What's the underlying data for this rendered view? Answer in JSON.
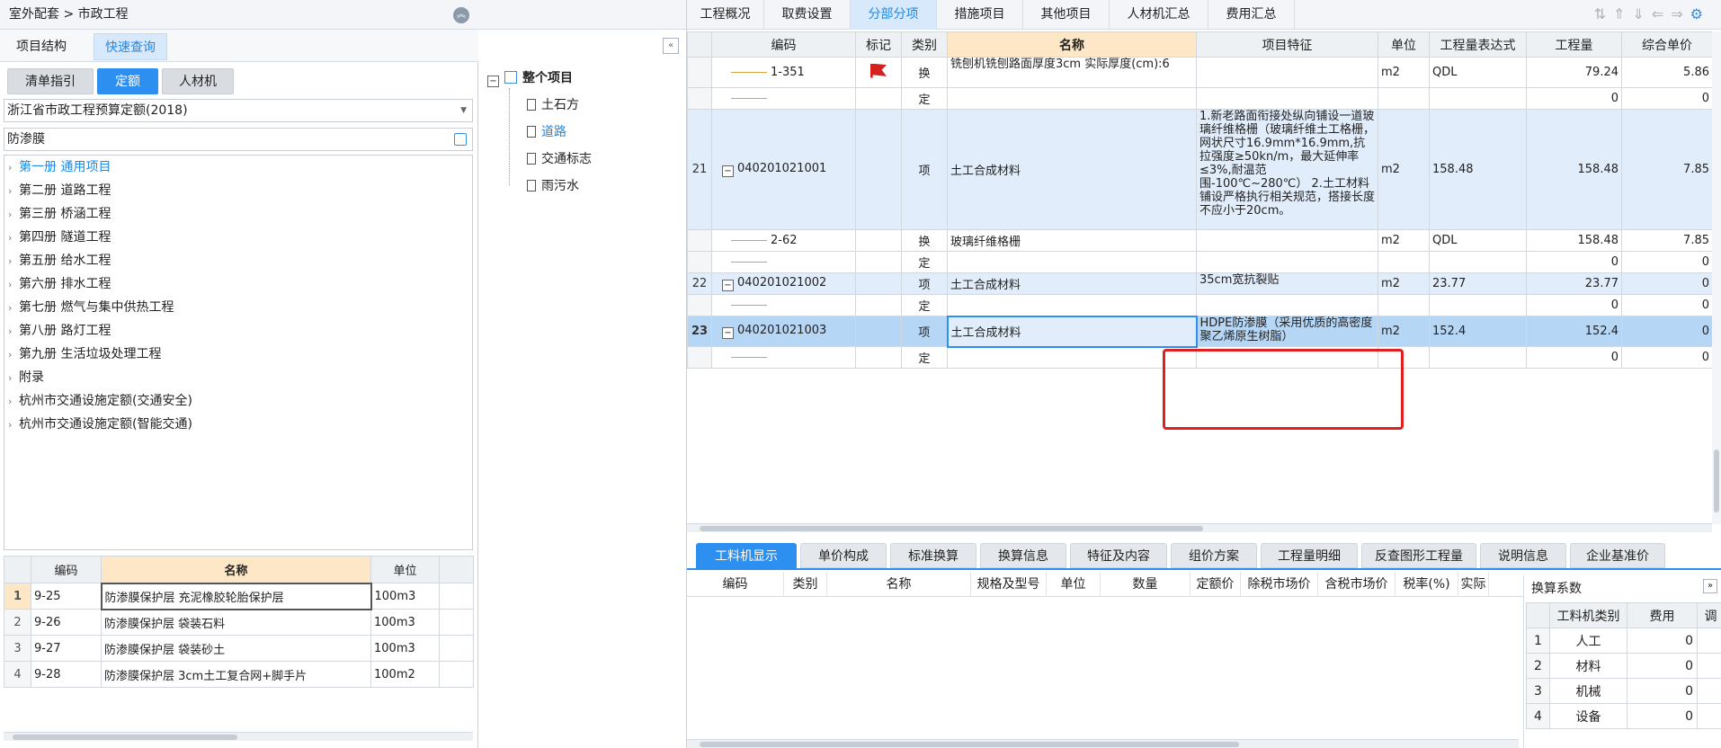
{
  "left": {
    "breadcrumb": "室外配套 > 市政工程",
    "tabs": [
      "项目结构",
      "快速查询"
    ],
    "subtabs": [
      "清单指引",
      "定额",
      "人材机"
    ],
    "quota_select": "浙江省市政工程预算定额(2018)",
    "search_value": "防渗膜",
    "tree": [
      "第一册 通用项目",
      "第二册 道路工程",
      "第三册 桥涵工程",
      "第四册 隧道工程",
      "第五册 给水工程",
      "第六册 排水工程",
      "第七册 燃气与集中供热工程",
      "第八册 路灯工程",
      "第九册 生活垃圾处理工程",
      "附录",
      "杭州市交通设施定额(交通安全)",
      "杭州市交通设施定额(智能交通)"
    ],
    "table": {
      "headers": [
        "编码",
        "名称",
        "单位"
      ],
      "rows": [
        {
          "n": "1",
          "code": "9-25",
          "name": "防渗膜保护层 充泥橡胶轮胎保护层",
          "unit": "100m3"
        },
        {
          "n": "2",
          "code": "9-26",
          "name": "防渗膜保护层 袋装石料",
          "unit": "100m3"
        },
        {
          "n": "3",
          "code": "9-27",
          "name": "防渗膜保护层 袋装砂土",
          "unit": "100m3"
        },
        {
          "n": "4",
          "code": "9-28",
          "name": "防渗膜保护层 3cm土工复合网+脚手片",
          "unit": "100m2"
        }
      ]
    }
  },
  "mid": {
    "root": "整个项目",
    "children": [
      "土石方",
      "道路",
      "交通标志",
      "雨污水"
    ]
  },
  "top_tabs": [
    "工程概况",
    "取费设置",
    "分部分项",
    "措施项目",
    "其他项目",
    "人材机汇总",
    "费用汇总"
  ],
  "grid": {
    "headers": [
      "编码",
      "标记",
      "类别",
      "名称",
      "项目特征",
      "单位",
      "工程量表达式",
      "工程量",
      "综合单价"
    ],
    "rows": [
      {
        "idx": "",
        "code": "1-351",
        "flag": true,
        "type": "换",
        "name": "铣刨机铣刨路面厚度3cm  实际厚度(cm):6",
        "feat": "",
        "unit": "m2",
        "expr": "QDL",
        "qty": "79.24",
        "price": "5.86",
        "style": ""
      },
      {
        "idx": "",
        "code": "",
        "flag": false,
        "type": "定",
        "name": "",
        "feat": "",
        "unit": "",
        "expr": "",
        "qty": "0",
        "price": "0",
        "style": ""
      },
      {
        "idx": "21",
        "code": "040201021001",
        "flag": false,
        "type": "项",
        "name": "土工合成材料",
        "feat": "1.新老路面衔接处纵向铺设一道玻璃纤维格栅（玻璃纤维土工格栅，网状尺寸16.9mm*16.9mm,抗拉强度≥50kn/m，最大延伸率≤3%,耐温范围-100℃~280℃）\n2.土工材料铺设严格执行相关规范，搭接长度不应小于20cm。",
        "unit": "m2",
        "expr": "158.48",
        "qty": "158.48",
        "price": "7.85",
        "style": "blue"
      },
      {
        "idx": "",
        "code": "2-62",
        "flag": false,
        "type": "换",
        "name": "玻璃纤维格栅",
        "feat": "",
        "unit": "m2",
        "expr": "QDL",
        "qty": "158.48",
        "price": "7.85",
        "style": ""
      },
      {
        "idx": "",
        "code": "",
        "flag": false,
        "type": "定",
        "name": "",
        "feat": "",
        "unit": "",
        "expr": "",
        "qty": "0",
        "price": "0",
        "style": ""
      },
      {
        "idx": "22",
        "code": "040201021002",
        "flag": false,
        "type": "项",
        "name": "土工合成材料",
        "feat": "35cm宽抗裂贴",
        "unit": "m2",
        "expr": "23.77",
        "qty": "23.77",
        "price": "0",
        "style": "blue"
      },
      {
        "idx": "",
        "code": "",
        "flag": false,
        "type": "定",
        "name": "",
        "feat": "",
        "unit": "",
        "expr": "",
        "qty": "0",
        "price": "0",
        "style": ""
      },
      {
        "idx": "23",
        "code": "040201021003",
        "flag": false,
        "type": "项",
        "name": "土工合成材料",
        "feat": "HDPE防渗膜（采用优质的高密度聚乙烯原生树脂）",
        "unit": "m2",
        "expr": "152.4",
        "qty": "152.4",
        "price": "0",
        "style": "dark"
      },
      {
        "idx": "",
        "code": "",
        "flag": false,
        "type": "定",
        "name": "",
        "feat": "",
        "unit": "",
        "expr": "",
        "qty": "0",
        "price": "0",
        "style": ""
      }
    ]
  },
  "bottom_tabs": [
    "工料机显示",
    "单价构成",
    "标准换算",
    "换算信息",
    "特征及内容",
    "组价方案",
    "工程量明细",
    "反查图形工程量",
    "说明信息",
    "企业基准价"
  ],
  "bottom_cols": [
    "编码",
    "类别",
    "名称",
    "规格及型号",
    "单位",
    "数量",
    "定额价",
    "除税市场价",
    "含税市场价",
    "税率(%)",
    "实际"
  ],
  "conversion": {
    "title": "换算系数",
    "headers": [
      "工料机类别",
      "费用",
      "调"
    ],
    "rows": [
      {
        "n": "1",
        "cat": "人工",
        "val": "0"
      },
      {
        "n": "2",
        "cat": "材料",
        "val": "0"
      },
      {
        "n": "3",
        "cat": "机械",
        "val": "0"
      },
      {
        "n": "4",
        "cat": "设备",
        "val": "0"
      }
    ]
  }
}
